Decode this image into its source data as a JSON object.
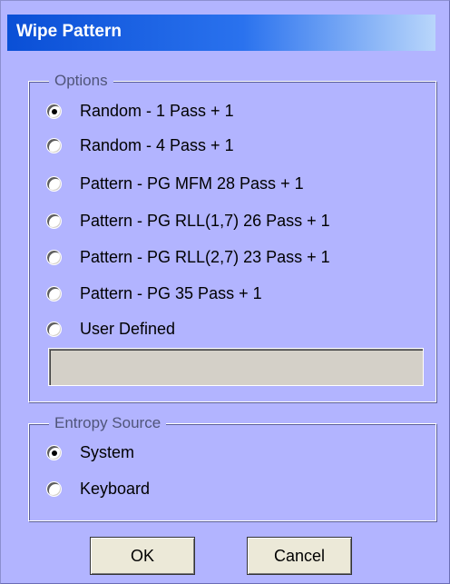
{
  "dialog": {
    "title": "Wipe Pattern"
  },
  "options_group": {
    "legend": "Options",
    "items": [
      {
        "label": "Random - 1 Pass + 1",
        "checked": true
      },
      {
        "label": "Random - 4 Pass + 1",
        "checked": false
      },
      {
        "label": "Pattern - PG MFM 28 Pass + 1",
        "checked": false
      },
      {
        "label": "Pattern - PG RLL(1,7) 26 Pass + 1",
        "checked": false
      },
      {
        "label": "Pattern - PG RLL(2,7) 23 Pass + 1",
        "checked": false
      },
      {
        "label": "Pattern - PG 35 Pass + 1",
        "checked": false
      },
      {
        "label": "User Defined",
        "checked": false
      }
    ],
    "user_defined_value": ""
  },
  "entropy_group": {
    "legend": "Entropy Source",
    "items": [
      {
        "label": "System",
        "checked": true
      },
      {
        "label": "Keyboard",
        "checked": false
      }
    ]
  },
  "buttons": {
    "ok_label": "OK",
    "cancel_label": "Cancel"
  }
}
